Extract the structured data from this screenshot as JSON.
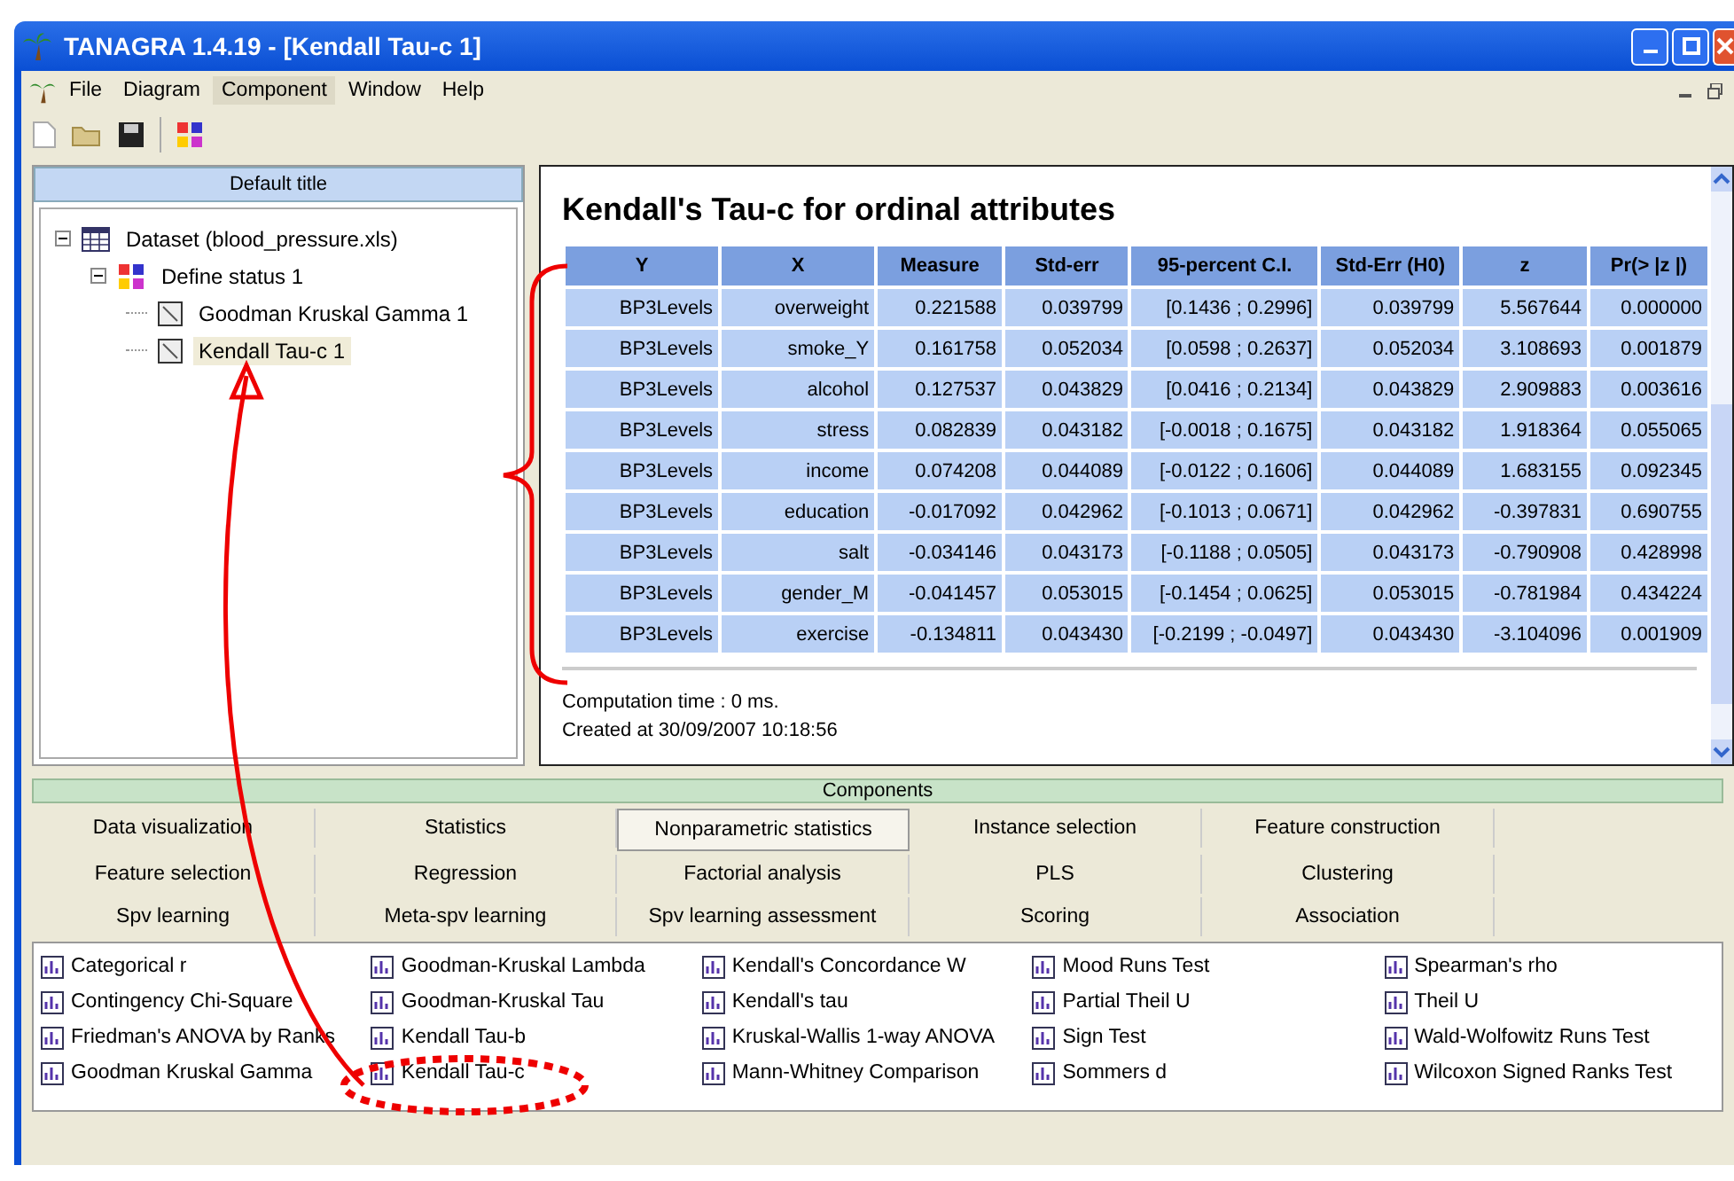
{
  "window": {
    "title": "TANAGRA 1.4.19 - [Kendall Tau-c 1]"
  },
  "menu": [
    {
      "label": "File",
      "selected": false
    },
    {
      "label": "Diagram",
      "selected": false
    },
    {
      "label": "Component",
      "selected": true
    },
    {
      "label": "Window",
      "selected": false
    },
    {
      "label": "Help",
      "selected": false
    }
  ],
  "diagram": {
    "title": "Default title",
    "tree": [
      {
        "label": "Dataset (blood_pressure.xls)",
        "kind": "dataset",
        "expanded": true,
        "selected": false,
        "children": [
          {
            "label": "Define status 1",
            "kind": "status",
            "expanded": true,
            "selected": false,
            "children": [
              {
                "label": "Goodman Kruskal Gamma 1",
                "kind": "method",
                "selected": false
              },
              {
                "label": "Kendall Tau-c 1",
                "kind": "method",
                "selected": true
              }
            ]
          }
        ]
      }
    ]
  },
  "report": {
    "title": "Kendall's Tau-c for ordinal attributes",
    "columns": [
      "Y",
      "X",
      "Measure",
      "Std-err",
      "95-percent C.I.",
      "Std-Err (H0)",
      "z",
      "Pr(> |z |)"
    ],
    "rows": [
      [
        "BP3Levels",
        "overweight",
        "0.221588",
        "0.039799",
        "[0.1436 ; 0.2996]",
        "0.039799",
        "5.567644",
        "0.000000"
      ],
      [
        "BP3Levels",
        "smoke_Y",
        "0.161758",
        "0.052034",
        "[0.0598 ; 0.2637]",
        "0.052034",
        "3.108693",
        "0.001879"
      ],
      [
        "BP3Levels",
        "alcohol",
        "0.127537",
        "0.043829",
        "[0.0416 ; 0.2134]",
        "0.043829",
        "2.909883",
        "0.003616"
      ],
      [
        "BP3Levels",
        "stress",
        "0.082839",
        "0.043182",
        "[-0.0018 ; 0.1675]",
        "0.043182",
        "1.918364",
        "0.055065"
      ],
      [
        "BP3Levels",
        "income",
        "0.074208",
        "0.044089",
        "[-0.0122 ; 0.1606]",
        "0.044089",
        "1.683155",
        "0.092345"
      ],
      [
        "BP3Levels",
        "education",
        "-0.017092",
        "0.042962",
        "[-0.1013 ; 0.0671]",
        "0.042962",
        "-0.397831",
        "0.690755"
      ],
      [
        "BP3Levels",
        "salt",
        "-0.034146",
        "0.043173",
        "[-0.1188 ; 0.0505]",
        "0.043173",
        "-0.790908",
        "0.428998"
      ],
      [
        "BP3Levels",
        "gender_M",
        "-0.041457",
        "0.053015",
        "[-0.1454 ; 0.0625]",
        "0.053015",
        "-0.781984",
        "0.434224"
      ],
      [
        "BP3Levels",
        "exercise",
        "-0.134811",
        "0.043430",
        "[-0.2199 ; -0.0497]",
        "0.043430",
        "-3.104096",
        "0.001909"
      ]
    ],
    "footer": [
      "Computation time : 0 ms.",
      "Created at 30/09/2007 10:18:56"
    ]
  },
  "components": {
    "title": "Components",
    "tabs": [
      {
        "label": "Data visualization",
        "selected": false
      },
      {
        "label": "Statistics",
        "selected": false
      },
      {
        "label": "Nonparametric statistics",
        "selected": true
      },
      {
        "label": "Instance selection",
        "selected": false
      },
      {
        "label": "Feature construction",
        "selected": false
      },
      {
        "label": "Feature selection",
        "selected": false
      },
      {
        "label": "Regression",
        "selected": false
      },
      {
        "label": "Factorial analysis",
        "selected": false
      },
      {
        "label": "PLS",
        "selected": false
      },
      {
        "label": "Clustering",
        "selected": false
      },
      {
        "label": "Spv learning",
        "selected": false
      },
      {
        "label": "Meta-spv learning",
        "selected": false
      },
      {
        "label": "Spv learning assessment",
        "selected": false
      },
      {
        "label": "Scoring",
        "selected": false
      },
      {
        "label": "Association",
        "selected": false
      }
    ],
    "items": [
      [
        "Categorical r",
        "Contingency Chi-Square",
        "Friedman's ANOVA by Ranks",
        "Goodman Kruskal Gamma"
      ],
      [
        "Goodman-Kruskal Lambda",
        "Goodman-Kruskal Tau",
        "Kendall Tau-b",
        "Kendall Tau-c"
      ],
      [
        "Kendall's Concordance W",
        "Kendall's tau",
        "Kruskal-Wallis 1-way ANOVA",
        "Mann-Whitney Comparison"
      ],
      [
        "Mood Runs Test",
        "Partial Theil U",
        "Sign Test",
        "Sommers d"
      ],
      [
        "Spearman's rho",
        "Theil U",
        "Wald-Wolfowitz Runs Test",
        "Wilcoxon Signed Ranks Test"
      ]
    ]
  }
}
